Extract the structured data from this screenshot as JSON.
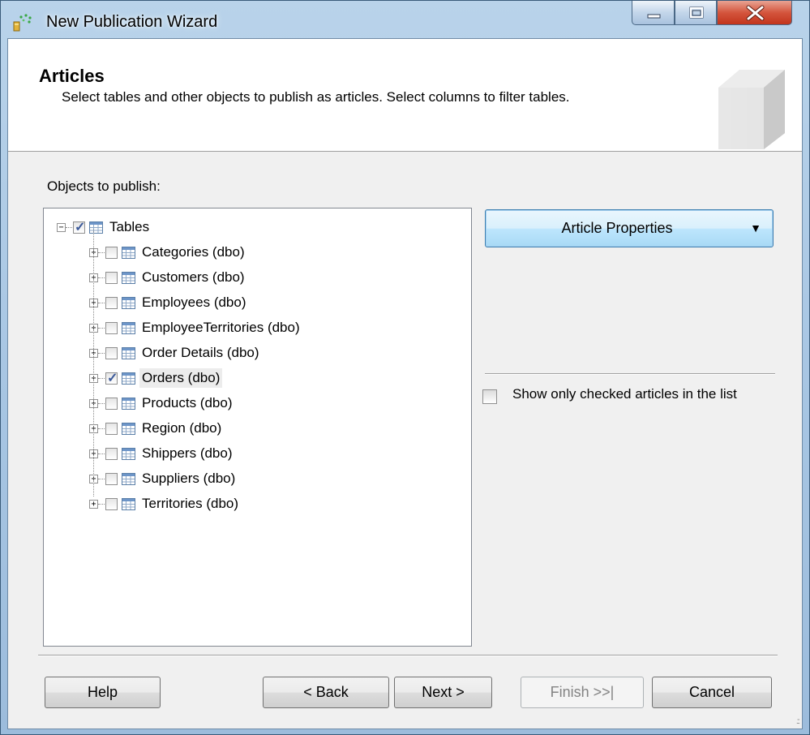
{
  "window": {
    "title": "New Publication Wizard"
  },
  "header": {
    "title": "Articles",
    "description": "Select tables and other objects to publish as articles. Select columns to filter tables."
  },
  "tree": {
    "label": "Objects to publish:",
    "root": {
      "label": "Tables",
      "checked": true,
      "expanded": true
    },
    "items": [
      {
        "label": "Categories (dbo)",
        "checked": false
      },
      {
        "label": "Customers (dbo)",
        "checked": false
      },
      {
        "label": "Employees (dbo)",
        "checked": false
      },
      {
        "label": "EmployeeTerritories (dbo)",
        "checked": false
      },
      {
        "label": "Order Details (dbo)",
        "checked": false
      },
      {
        "label": "Orders (dbo)",
        "checked": true,
        "selected": true
      },
      {
        "label": "Products (dbo)",
        "checked": false
      },
      {
        "label": "Region (dbo)",
        "checked": false
      },
      {
        "label": "Shippers (dbo)",
        "checked": false
      },
      {
        "label": "Suppliers (dbo)",
        "checked": false
      },
      {
        "label": "Territories (dbo)",
        "checked": false
      }
    ]
  },
  "article_properties": {
    "label": "Article Properties"
  },
  "show_checked": {
    "label": "Show only checked articles in the list",
    "checked": false
  },
  "buttons": {
    "help": "Help",
    "back": "< Back",
    "next": "Next >",
    "finish": "Finish >>|",
    "cancel": "Cancel"
  }
}
